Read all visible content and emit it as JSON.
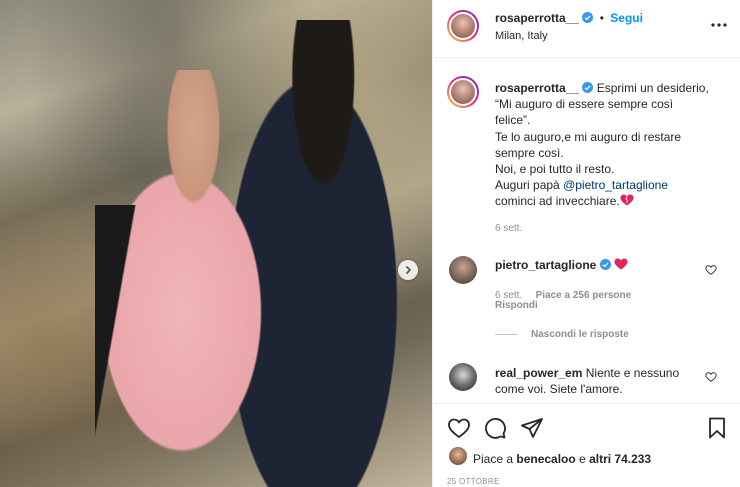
{
  "post": {
    "username": "rosaperrotta__",
    "follow_label": "Segui",
    "separator": "•",
    "location": "Milan, Italy",
    "more_icon": "more-options-icon"
  },
  "caption": {
    "username": "rosaperrotta__",
    "lines": [
      "Esprimi un desiderio,",
      "“Mi auguro di essere sempre così",
      "felice”.",
      "Te lo auguro,e mi auguro di restare",
      "sempre così.",
      "Noi, e poi tutto il resto.",
      "Auguri papà"
    ],
    "mention": "@pietro_tartaglione",
    "last_line": "cominci ad invecchiare.",
    "time": "6 sett."
  },
  "comments": [
    {
      "username": "pietro_tartaglione",
      "text": "",
      "time": "6 sett.",
      "likes": "Piace a 256 persone",
      "reply": "Rispondi"
    },
    {
      "username": "real_power_em",
      "text_line1": "Niente e nessuno",
      "text_line2": "come voi. Siete l'amore."
    }
  ],
  "hide_replies": "Nascondi le risposte",
  "likes": {
    "prefix": "Piace a ",
    "user": "benecaloo",
    "middle": " e ",
    "others": "altri 74.233"
  },
  "date": "25 OTTOBRE",
  "colors": {
    "accent": "#0095f6",
    "heart": "#ed4956",
    "mention": "#00376b",
    "secondary": "#8e8e8e"
  }
}
